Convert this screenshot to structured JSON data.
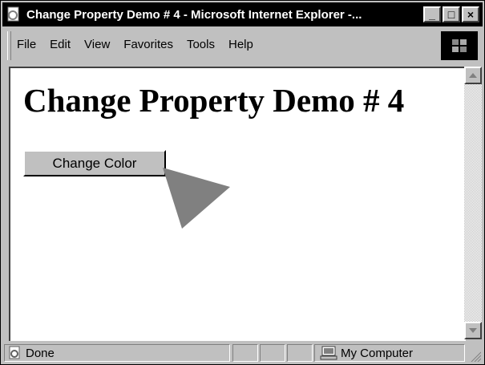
{
  "window": {
    "title": "Change Property Demo # 4 - Microsoft Internet Explorer -..."
  },
  "title_buttons": {
    "minimize": "_",
    "maximize": "□",
    "close": "×"
  },
  "menu": {
    "items": [
      "File",
      "Edit",
      "View",
      "Favorites",
      "Tools",
      "Help"
    ]
  },
  "page": {
    "heading": "Change Property Demo # 4",
    "button_label": "Change Color"
  },
  "status": {
    "text": "Done",
    "zone": "My Computer"
  },
  "icons": {
    "titlebar": "ie-page-icon",
    "logo": "windows-logo-icon",
    "status": "ie-page-icon",
    "zone": "computer-icon"
  },
  "colors": {
    "titlebar": "#000000",
    "chrome": "#c0c0c0",
    "button": "#c0c0c0",
    "cursor": "#808080"
  }
}
